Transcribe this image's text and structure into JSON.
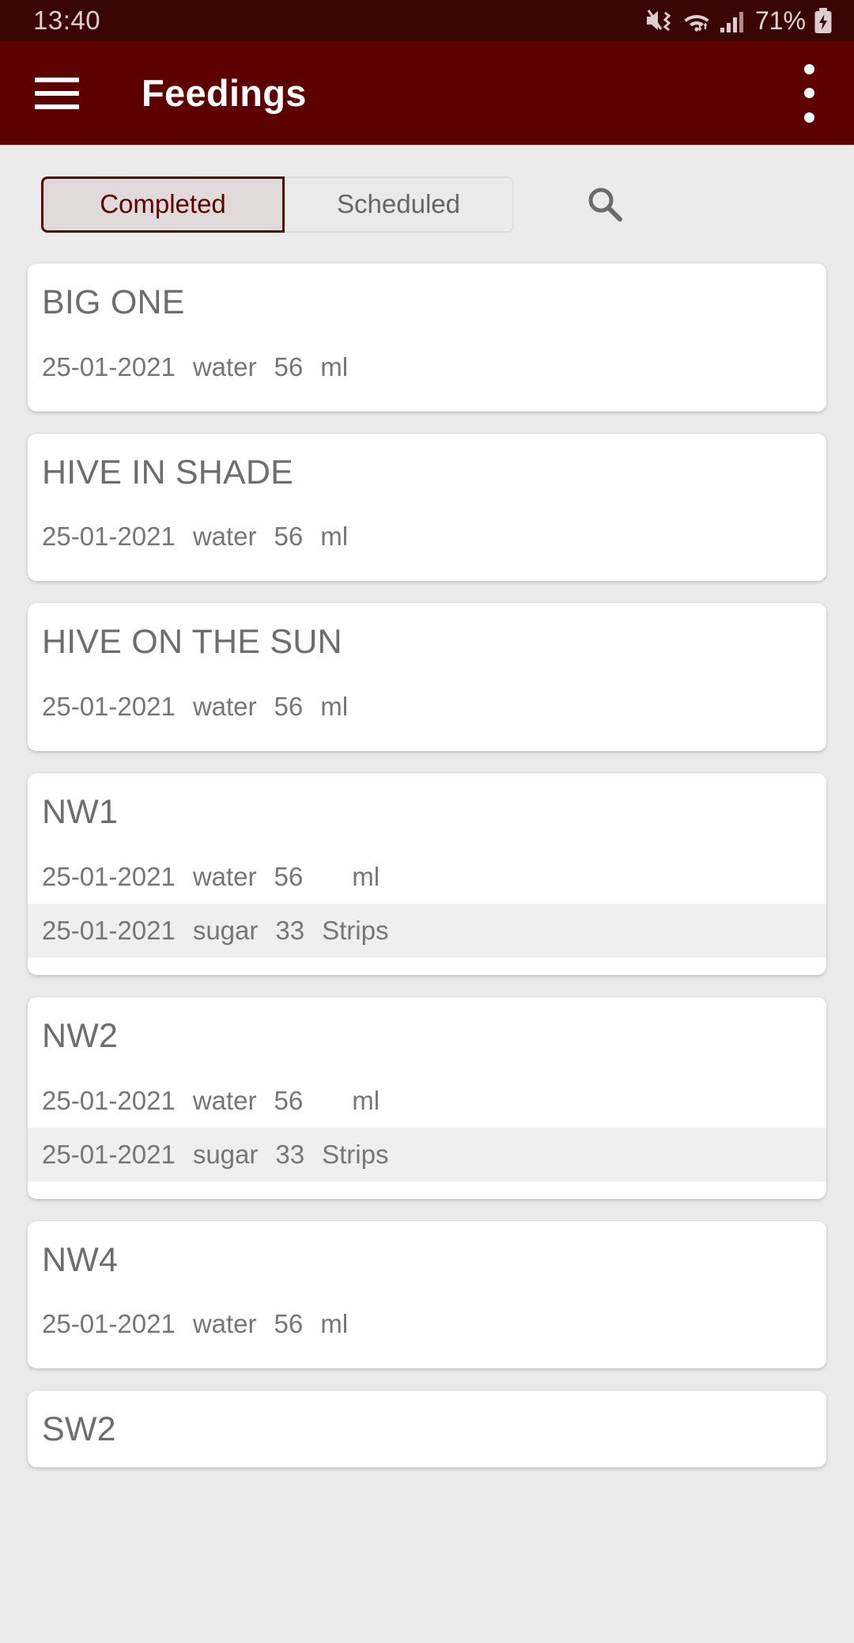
{
  "status_bar": {
    "time": "13:40",
    "battery_percent": "71%",
    "icons": [
      "mute-vibrate-icon",
      "wifi-icon",
      "cell-signal-icon",
      "battery-charging-icon"
    ]
  },
  "app_bar": {
    "menu_icon": "hamburger-menu-icon",
    "title": "Feedings",
    "overflow_icon": "overflow-menu-icon"
  },
  "toolbar": {
    "tabs": [
      {
        "label": "Completed",
        "selected": true
      },
      {
        "label": "Scheduled",
        "selected": false
      }
    ],
    "search_icon": "search-icon",
    "accent_color": "#5d0000"
  },
  "list": {
    "cards": [
      {
        "title": "BIG ONE",
        "rows": [
          {
            "date": "25-01-2021",
            "type": "water",
            "amount": "56",
            "unit": "ml",
            "striped": false,
            "wide": false
          }
        ]
      },
      {
        "title": "HIVE IN SHADE",
        "rows": [
          {
            "date": "25-01-2021",
            "type": "water",
            "amount": "56",
            "unit": "ml",
            "striped": false,
            "wide": false
          }
        ]
      },
      {
        "title": "HIVE ON THE SUN",
        "rows": [
          {
            "date": "25-01-2021",
            "type": "water",
            "amount": "56",
            "unit": "ml",
            "striped": false,
            "wide": false
          }
        ]
      },
      {
        "title": "NW1",
        "rows": [
          {
            "date": "25-01-2021",
            "type": "water",
            "amount": "56",
            "unit": "ml",
            "striped": false,
            "wide": true
          },
          {
            "date": "25-01-2021",
            "type": "sugar",
            "amount": "33",
            "unit": "Strips",
            "striped": true,
            "wide": false
          }
        ]
      },
      {
        "title": "NW2",
        "rows": [
          {
            "date": "25-01-2021",
            "type": "water",
            "amount": "56",
            "unit": "ml",
            "striped": false,
            "wide": true
          },
          {
            "date": "25-01-2021",
            "type": "sugar",
            "amount": "33",
            "unit": "Strips",
            "striped": true,
            "wide": false
          }
        ]
      },
      {
        "title": "NW4",
        "rows": [
          {
            "date": "25-01-2021",
            "type": "water",
            "amount": "56",
            "unit": "ml",
            "striped": false,
            "wide": false
          }
        ]
      },
      {
        "title": "SW2",
        "rows": []
      }
    ]
  }
}
